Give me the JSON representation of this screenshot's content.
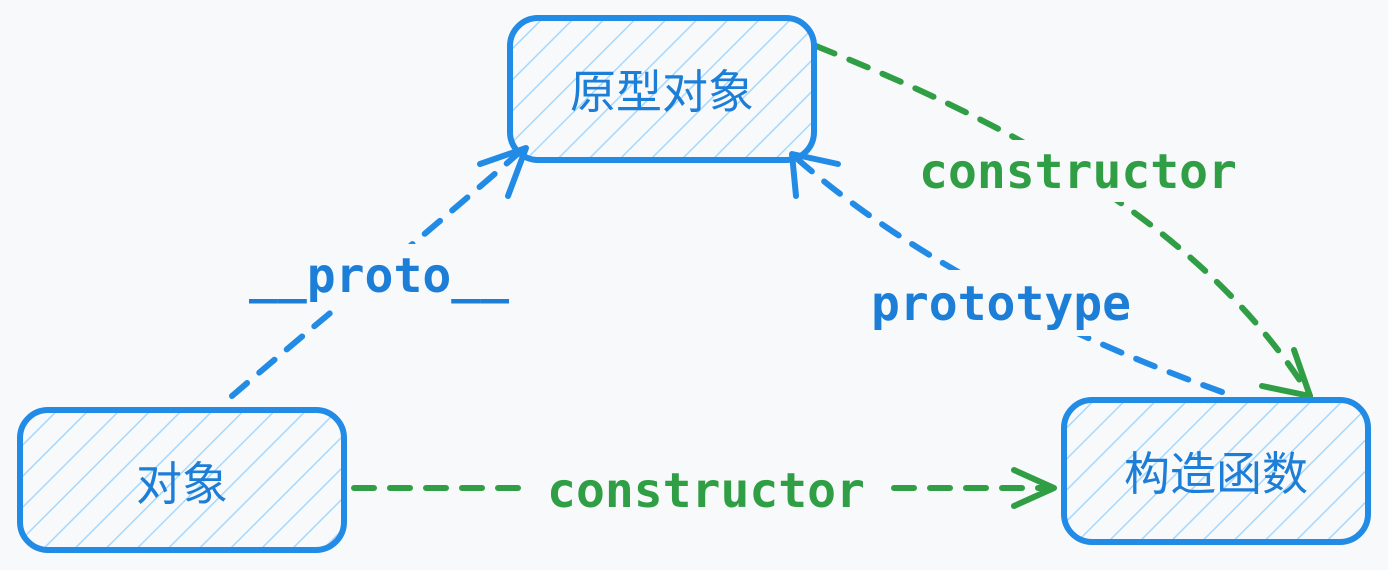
{
  "colors": {
    "node_stroke": "#228be6",
    "node_hatch": "#a5d8ff",
    "blue_edge": "#228be6",
    "green_edge": "#2f9e44",
    "background": "#f8f9fa"
  },
  "nodes": {
    "prototype_object": {
      "label": "原型对象"
    },
    "object": {
      "label": "对象"
    },
    "constructor_function": {
      "label": "构造函数"
    }
  },
  "edges": {
    "object_to_prototype": {
      "label": "__proto__"
    },
    "function_to_prototype": {
      "label": "prototype"
    },
    "prototype_to_function": {
      "label": "constructor"
    },
    "object_to_function": {
      "label": "constructor"
    }
  }
}
